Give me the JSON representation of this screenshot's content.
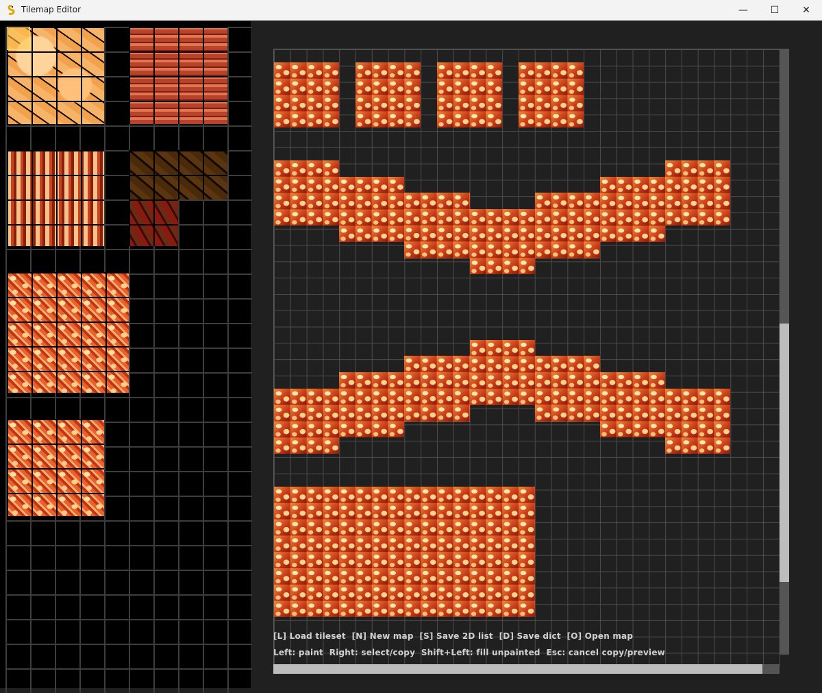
{
  "window": {
    "title": "Tilemap Editor",
    "icon": "pygame-snake-icon",
    "controls": [
      "minimize-icon",
      "maximize-icon",
      "close-icon"
    ],
    "control_glyphs": {
      "minimize": "—",
      "maximize": "☐",
      "close": "✕"
    }
  },
  "palette": {
    "tilesets": [
      "sandstone",
      "brick",
      "red-wall",
      "dark-rock",
      "lava-rock",
      "lava-rock-small"
    ],
    "selection_color": "#ffd060"
  },
  "map": {
    "grid_color": "#4c4c4c",
    "background": "#202020"
  },
  "help": {
    "line1": "[L] Load tileset  [N] New map  [S] Save 2D list  [D] Save dict  [O] Open map",
    "line2": "Left: paint  Right: select/copy  Shift+Left: fill unpainted  Esc: cancel copy/preview"
  },
  "colors": {
    "lava_light": "#ffd38e",
    "lava_mid": "#f08a3a",
    "lava_dark": "#8a1a0c",
    "scroll_thumb": "#bdbdbd",
    "scroll_track": "#555555"
  }
}
